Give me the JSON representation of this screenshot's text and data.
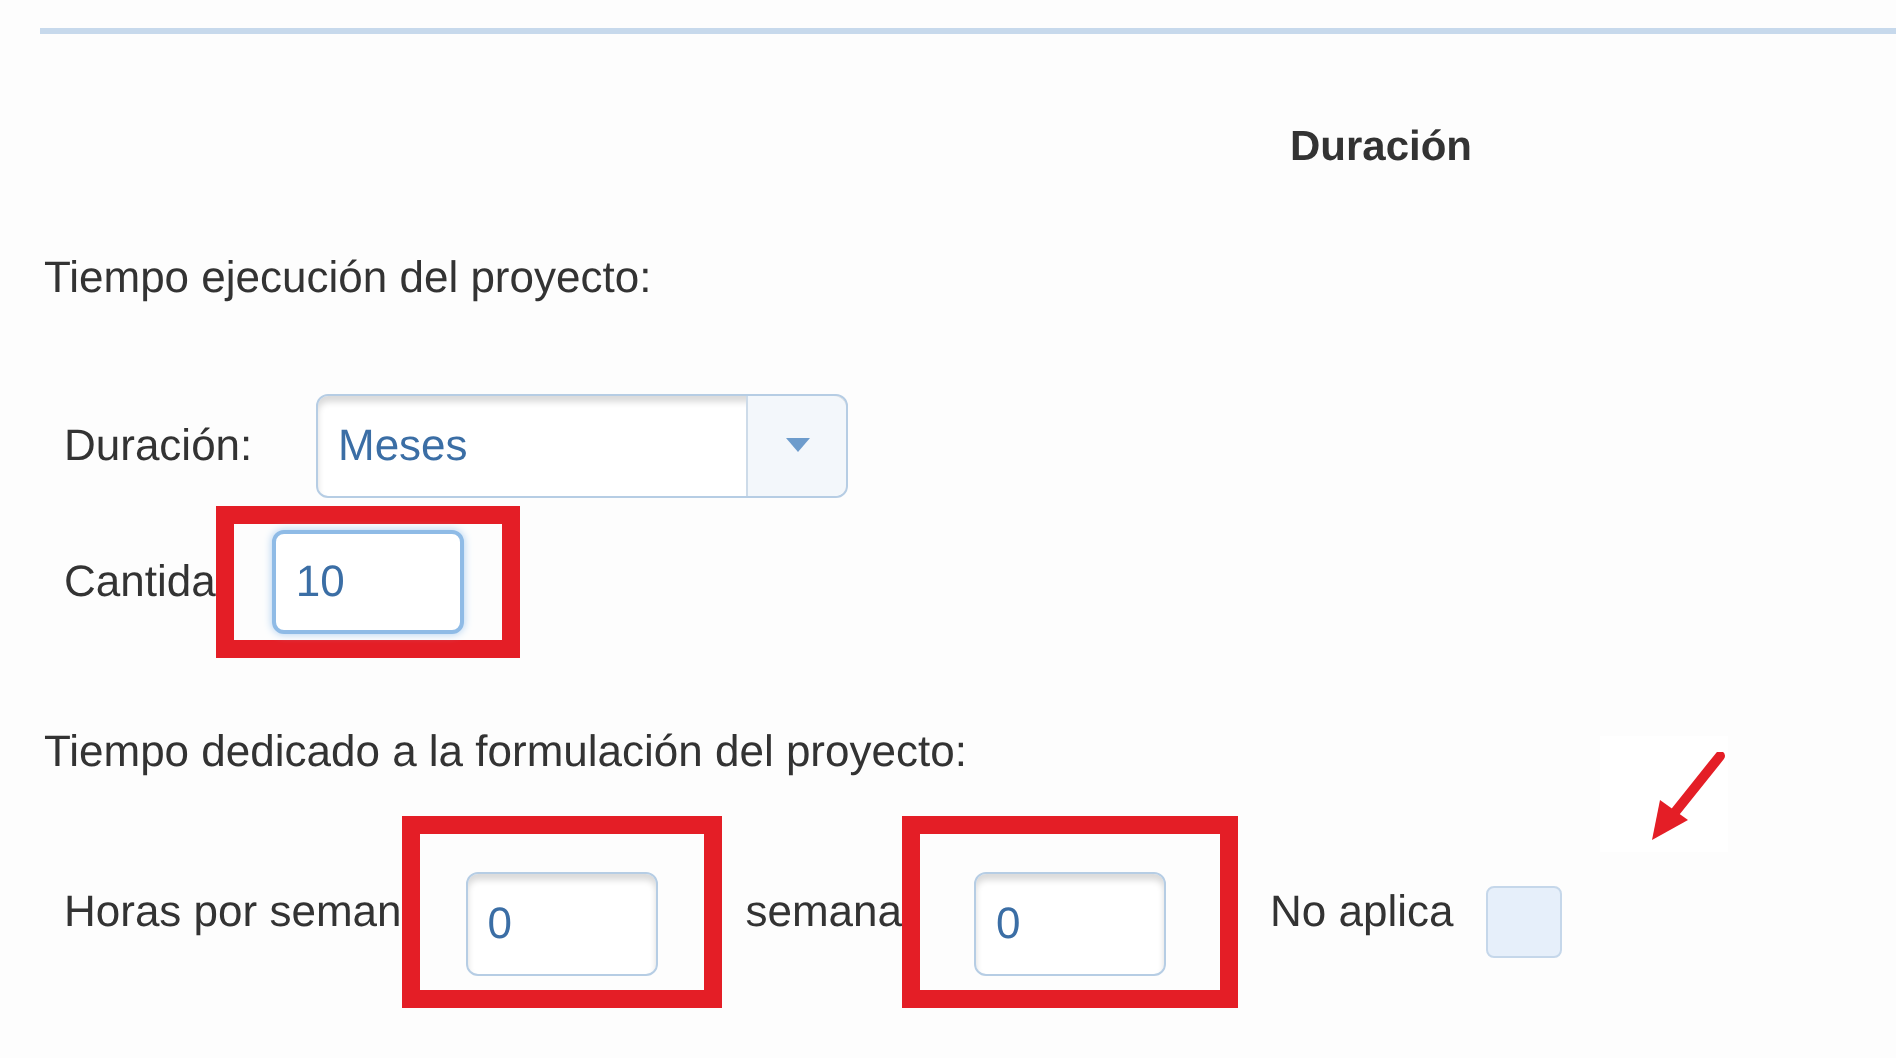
{
  "section_title": "Duración",
  "execution": {
    "heading": "Tiempo ejecución del proyecto:",
    "duration": {
      "label": "Duración:",
      "value": "Meses"
    },
    "quantity": {
      "label": "Cantida",
      "value": "10"
    }
  },
  "formulation": {
    "heading": "Tiempo dedicado a la formulación del proyecto:",
    "hours": {
      "label": "Horas por seman",
      "value": "0"
    },
    "weeks": {
      "label": "semana",
      "value": "0"
    },
    "not_applicable": {
      "label": "No aplica",
      "checked": false
    }
  }
}
